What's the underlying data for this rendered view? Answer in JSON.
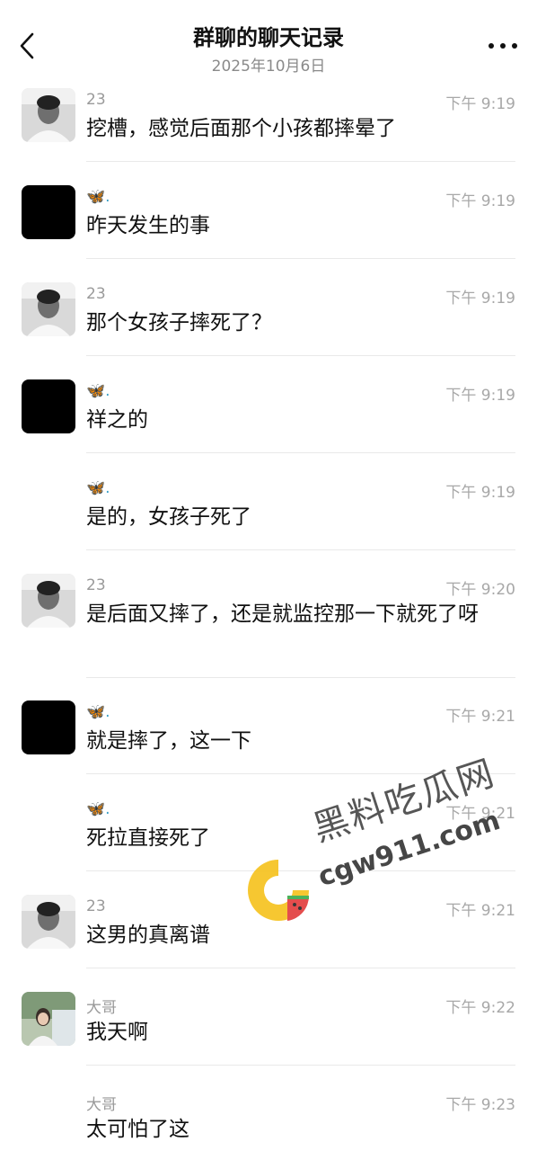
{
  "header": {
    "title": "群聊的聊天记录",
    "date": "2025年10月6日",
    "back_icon": "chevron-left-icon",
    "more_icon": "more-dots-icon"
  },
  "messages": [
    {
      "sender": "23",
      "time": "下午 9:19",
      "text": "挖槽，感觉后面那个小孩都摔晕了"
    },
    {
      "sender": "🦋.",
      "time": "下午 9:19",
      "text": "昨天发生的事"
    },
    {
      "sender": "23",
      "time": "下午 9:19",
      "text": "那个女孩子摔死了？"
    },
    {
      "sender": "🦋.",
      "time": "下午 9:19",
      "text": "祥之的"
    },
    {
      "sender": "🦋.",
      "time": "下午 9:19",
      "text": "是的，女孩子死了"
    },
    {
      "sender": "23",
      "time": "下午 9:20",
      "text": "是后面又摔了，还是就监控那一下就死了呀"
    },
    {
      "sender": "🦋.",
      "time": "下午 9:21",
      "text": "就是摔了，这一下"
    },
    {
      "sender": "🦋.",
      "time": "下午 9:21",
      "text": "死拉直接死了"
    },
    {
      "sender": "23",
      "time": "下午 9:21",
      "text": "这男的真离谱"
    },
    {
      "sender": "大哥",
      "time": "下午 9:22",
      "text": "我天啊"
    },
    {
      "sender": "大哥",
      "time": "下午 9:23",
      "text": "太可怕了这"
    }
  ],
  "watermark": {
    "line1": "黑料吃瓜网",
    "line2": "cgw911.com"
  },
  "colors": {
    "text": "#111111",
    "muted": "#9a9a9a",
    "separator": "#e9e9e9",
    "butterfly": "#3aa0c8",
    "logo_yellow": "#f6c21b",
    "logo_green": "#3aaa4a",
    "logo_red": "#e23a3a"
  }
}
